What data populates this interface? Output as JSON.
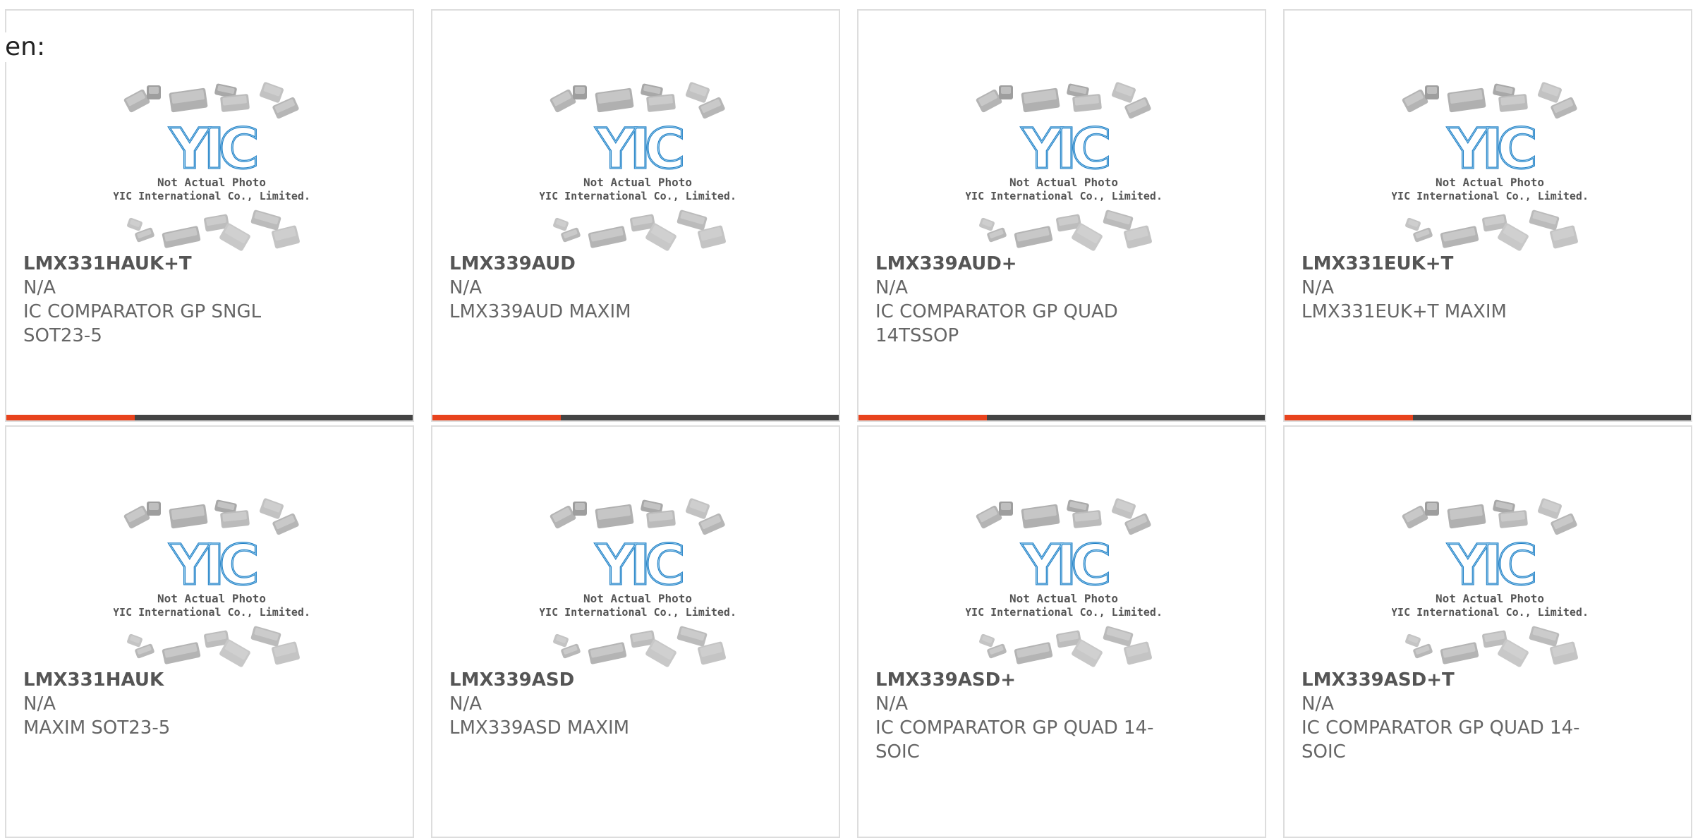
{
  "language_label": "en:",
  "placeholder_image": {
    "logo_text": "YIC",
    "line1": "Not Actual Photo",
    "line2": "YIC International Co., Limited."
  },
  "colors": {
    "accent": "#e8431d",
    "bar": "#444444",
    "logo": "#1f7ec4",
    "border": "#dddddd"
  },
  "products": [
    {
      "part": "LMX331HAUK+T",
      "manufacturer": "N/A",
      "description": "IC COMPARATOR GP SNGL SOT23-5",
      "accent_bar": true
    },
    {
      "part": "LMX339AUD",
      "manufacturer": "N/A",
      "description": "LMX339AUD MAXIM",
      "accent_bar": true
    },
    {
      "part": "LMX339AUD+",
      "manufacturer": "N/A",
      "description": "IC COMPARATOR GP QUAD 14TSSOP",
      "accent_bar": true
    },
    {
      "part": "LMX331EUK+T",
      "manufacturer": "N/A",
      "description": "LMX331EUK+T MAXIM",
      "accent_bar": true
    },
    {
      "part": "LMX331HAUK",
      "manufacturer": "N/A",
      "description": "MAXIM SOT23-5",
      "accent_bar": false
    },
    {
      "part": "LMX339ASD",
      "manufacturer": "N/A",
      "description": "LMX339ASD MAXIM",
      "accent_bar": false
    },
    {
      "part": "LMX339ASD+",
      "manufacturer": "N/A",
      "description": "IC COMPARATOR GP QUAD 14-SOIC",
      "accent_bar": false
    },
    {
      "part": "LMX339ASD+T",
      "manufacturer": "N/A",
      "description": "IC COMPARATOR GP QUAD 14-SOIC",
      "accent_bar": false
    }
  ]
}
